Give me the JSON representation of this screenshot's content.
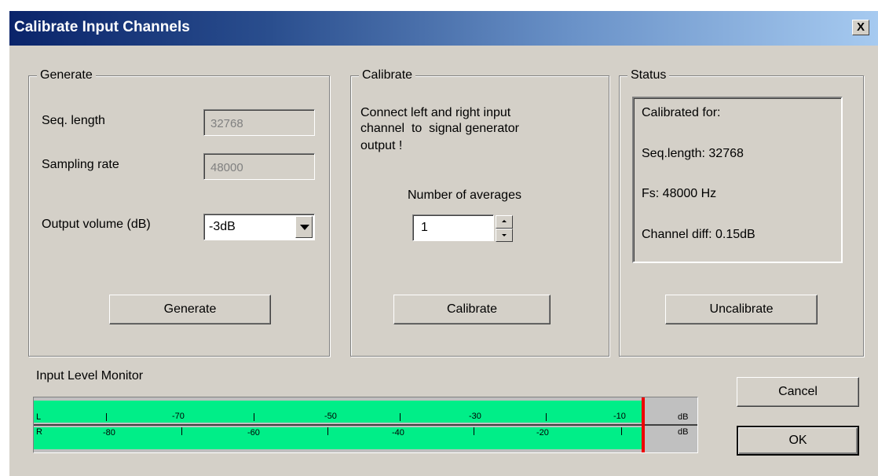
{
  "window": {
    "title": "Calibrate Input Channels",
    "close_glyph": "X"
  },
  "generate": {
    "legend": "Generate",
    "seq_length_label": "Seq. length",
    "seq_length_value": "32768",
    "sampling_rate_label": "Sampling rate",
    "sampling_rate_value": "48000",
    "output_volume_label": "Output volume (dB)",
    "output_volume_value": "-3dB",
    "button": "Generate"
  },
  "calibrate": {
    "legend": "Calibrate",
    "instruction_1": "Connect left and right input",
    "instruction_2": "channel  to  signal generator",
    "instruction_3": "output !",
    "averages_label": "Number of averages",
    "averages_value": "1",
    "button": "Calibrate"
  },
  "status": {
    "legend": "Status",
    "line1": "Calibrated for:",
    "line2": "Seq.length: 32768",
    "line3": "Fs: 48000 Hz",
    "line4": "Channel diff: 0.15dB",
    "button": "Uncalibrate"
  },
  "monitor": {
    "label": "Input Level Monitor",
    "channel_l": "L",
    "channel_r": "R",
    "unit": "dB",
    "l_ticks": [
      "-70",
      "-50",
      "-30",
      "-10"
    ],
    "r_ticks": [
      "-80",
      "-60",
      "-40",
      "-20"
    ],
    "level_l_fraction": 0.92,
    "level_r_fraction": 0.92,
    "colors": {
      "level": "#00ee88",
      "peak": "#ee0000",
      "background": "#c0c0c0"
    }
  },
  "buttons": {
    "cancel": "Cancel",
    "ok": "OK"
  }
}
